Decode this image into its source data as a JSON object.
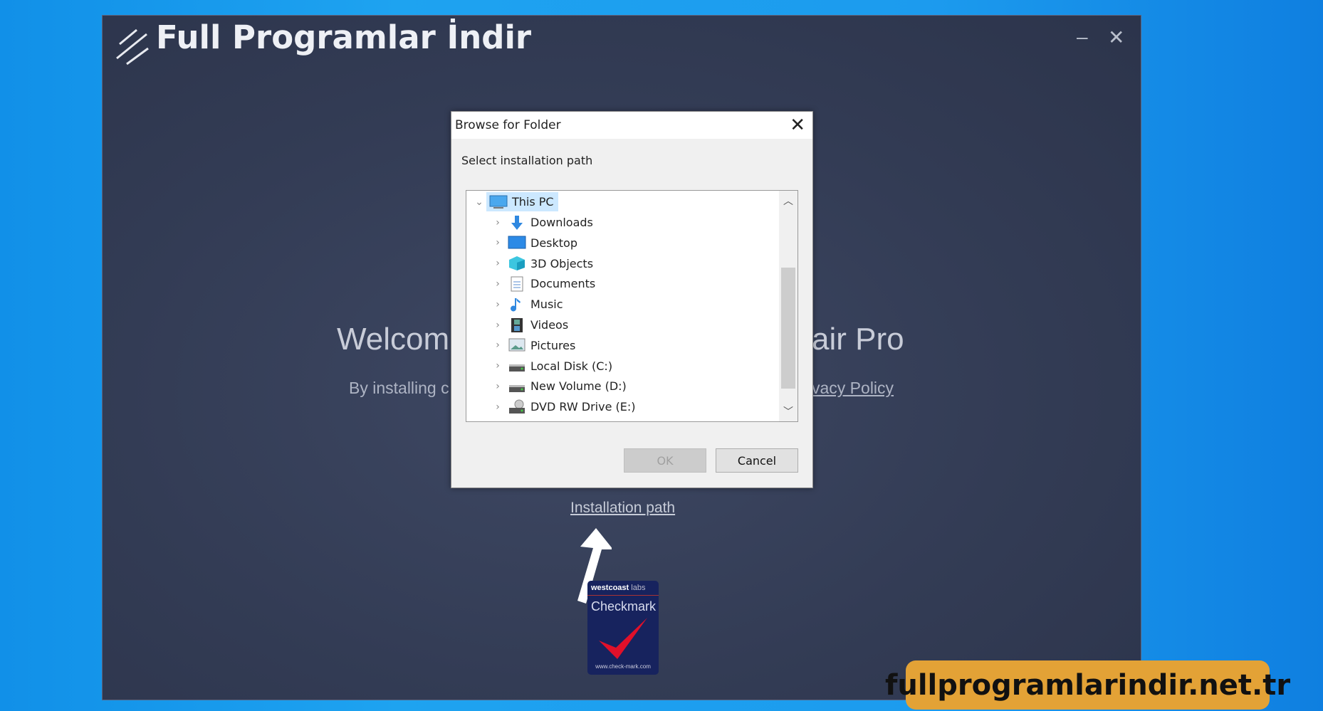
{
  "app": {
    "title": "Full Programlar İndir",
    "minimize_icon": "minimize-icon",
    "close_icon": "close-icon"
  },
  "welcome": {
    "left": "Welcome",
    "right": "air Pro",
    "sub_left": "By installing c",
    "sub_link": "vacy Policy"
  },
  "installation_path_link": "Installation path",
  "badge": {
    "brand": "westcoast",
    "labs": "labs",
    "name": "Checkmark",
    "url": "www.check-mark.com"
  },
  "dialog": {
    "title": "Browse for Folder",
    "label": "Select installation path",
    "ok": "OK",
    "cancel": "Cancel",
    "root": {
      "label": "This PC",
      "expanded": true,
      "selected": true
    },
    "items": [
      {
        "label": "Downloads",
        "icon": "download-icon"
      },
      {
        "label": "Desktop",
        "icon": "desktop-icon"
      },
      {
        "label": "3D Objects",
        "icon": "cube-icon"
      },
      {
        "label": "Documents",
        "icon": "document-icon"
      },
      {
        "label": "Music",
        "icon": "music-icon"
      },
      {
        "label": "Videos",
        "icon": "video-icon"
      },
      {
        "label": "Pictures",
        "icon": "picture-icon"
      },
      {
        "label": "Local Disk (C:)",
        "icon": "drive-icon"
      },
      {
        "label": "New Volume (D:)",
        "icon": "drive-icon"
      },
      {
        "label": "DVD RW Drive (E:)",
        "icon": "dvd-drive-icon"
      }
    ]
  },
  "watermark": "fullprogramlarindir.net.tr",
  "colors": {
    "accent": "#e3a236",
    "window": "#333c55",
    "selection": "#cce8ff"
  }
}
